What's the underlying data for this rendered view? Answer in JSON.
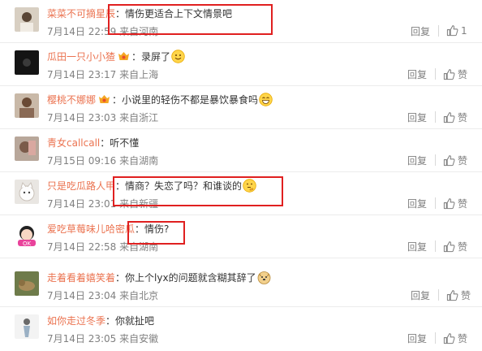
{
  "labels": {
    "reply": "回复",
    "like": "赞"
  },
  "comments": [
    {
      "user": "菜菜不可摘星辰",
      "text": "情伤更适合上下文情景吧",
      "date": "7月14日",
      "time": "22:59",
      "from": "来自河南",
      "likes": "1",
      "emoji": ""
    },
    {
      "user": "瓜田一只小小猹",
      "text": "录屏了",
      "date": "7月14日",
      "time": "23:17",
      "from": "来自上海",
      "likes": "赞",
      "emoji": "smile"
    },
    {
      "user": "樱桃不娜娜",
      "text": "小说里的轻伤不都是暴饮暴食吗",
      "date": "7月14日",
      "time": "23:03",
      "from": "来自浙江",
      "likes": "赞",
      "emoji": "grin"
    },
    {
      "user": "青女callcall",
      "text": "听不懂",
      "date": "7月15日",
      "time": "09:16",
      "from": "来自湖南",
      "likes": "赞",
      "emoji": ""
    },
    {
      "user": "只是吃瓜路人甲",
      "text": "情商？失恋了吗？和谁谈的",
      "date": "7月14日",
      "time": "23:01",
      "from": "来自新疆",
      "likes": "赞",
      "emoji": "think"
    },
    {
      "user": "爱吃草莓味儿哈密瓜",
      "text": "情伤?",
      "date": "7月14日",
      "time": "22:58",
      "from": "来自湖南",
      "likes": "赞",
      "emoji": ""
    },
    {
      "user": "走着看着嬉笑着",
      "text": "你上个lyx的问题就含糊其辞了",
      "date": "7月14日",
      "time": "23:04",
      "from": "来自北京",
      "likes": "赞",
      "emoji": "doge"
    },
    {
      "user": "如你走过冬季",
      "text": "你就扯吧",
      "date": "7月14日",
      "time": "23:05",
      "from": "来自安徽",
      "likes": "赞",
      "emoji": ""
    }
  ],
  "colors": {
    "username": "#eb7350",
    "meta": "#808080",
    "highlight": "#e02020"
  }
}
